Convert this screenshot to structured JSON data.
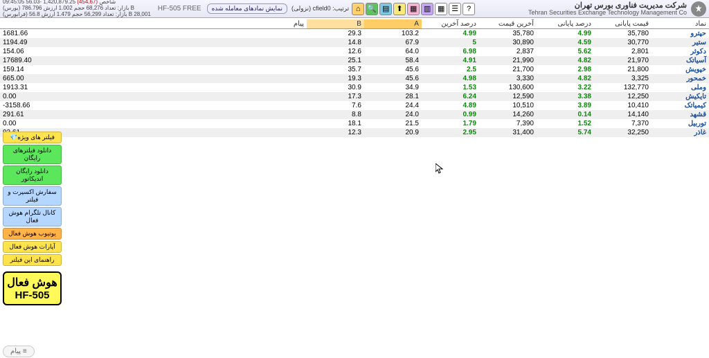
{
  "header": {
    "brand_fa": "شرکت مدیریت فناوری بورس تهران",
    "brand_en": "Tehran Securities Exchange Technology Management Co",
    "sort_label": "ترتیب:",
    "sort_value": "cfield0 (نزولی)",
    "tab_label": "نمایش نمادهای معامله شده",
    "hf": "HF-505 FREE",
    "stats": {
      "l1a": "شاخص",
      "l1b": "1,420,879.25",
      "l1c": "(454.67)",
      "l1d": "-56.03 09:45:05",
      "l2a": "(بورس)",
      "l2b": "بازار: تعداد 68,276 حجم 1.002 ارزش 786.796 B",
      "l3a": "(فرابورس)",
      "l3b": "بازار: تعداد 56,299 حجم 1.479 ارزش 56.8 B 28,001"
    }
  },
  "columns": [
    "نماد",
    "قیمت پایانی",
    "درصد پایانی",
    "آخرین قیمت",
    "درصد آخرین",
    "A",
    "B",
    "پیام"
  ],
  "rows": [
    {
      "sym": "حپترو",
      "close": "35,780",
      "closePct": "4.99",
      "last": "35,780",
      "lastPct": "4.99",
      "a": "103.2",
      "b": "29.3",
      "msg": "1681.66"
    },
    {
      "sym": "ستیر",
      "close": "30,770",
      "closePct": "4.59",
      "last": "30,890",
      "lastPct": "5",
      "a": "67.9",
      "b": "14.8",
      "msg": "1194.49"
    },
    {
      "sym": "دکوثر",
      "close": "2,801",
      "closePct": "5.62",
      "last": "2,837",
      "lastPct": "6.98",
      "a": "64.0",
      "b": "12.6",
      "msg": "154.06"
    },
    {
      "sym": "آسیاتک",
      "close": "21,970",
      "closePct": "4.82",
      "last": "21,990",
      "lastPct": "4.91",
      "a": "58.4",
      "b": "25.1",
      "msg": "17689.40"
    },
    {
      "sym": "خپویش",
      "close": "21,800",
      "closePct": "2.98",
      "last": "21,700",
      "lastPct": "2.5",
      "a": "45.6",
      "b": "35.7",
      "msg": "159.14"
    },
    {
      "sym": "خمحور",
      "close": "3,325",
      "closePct": "4.82",
      "last": "3,330",
      "lastPct": "4.98",
      "a": "45.6",
      "b": "19.3",
      "msg": "665.00"
    },
    {
      "sym": "وملی",
      "close": "132,770",
      "closePct": "3.22",
      "last": "130,600",
      "lastPct": "1.53",
      "a": "34.9",
      "b": "30.9",
      "msg": "1913.31"
    },
    {
      "sym": "تایکیش",
      "close": "12,250",
      "closePct": "3.38",
      "last": "12,590",
      "lastPct": "6.24",
      "a": "28.1",
      "b": "17.3",
      "msg": "0.00"
    },
    {
      "sym": "کیمیاتک",
      "close": "10,410",
      "closePct": "3.89",
      "last": "10,510",
      "lastPct": "4.89",
      "a": "24.4",
      "b": "7.6",
      "msg": "-3158.66"
    },
    {
      "sym": "قشهد",
      "close": "14,140",
      "closePct": "0.14",
      "last": "14,260",
      "lastPct": "0.99",
      "a": "24.0",
      "b": "8.8",
      "msg": "291.61"
    },
    {
      "sym": "توربیل",
      "close": "7,370",
      "closePct": "1.52",
      "last": "7,390",
      "lastPct": "1.79",
      "a": "21.5",
      "b": "18.1",
      "msg": "0.00"
    },
    {
      "sym": "غاذر",
      "close": "32,250",
      "closePct": "5.74",
      "last": "31,400",
      "lastPct": "2.95",
      "a": "20.9",
      "b": "12.3",
      "msg": "93.61"
    }
  ],
  "side": [
    "فیلتر های ویژه💎",
    "دانلود فیلترهای رایگان",
    "دانلود رایگان اندیکاتور",
    "سفارش اکسپرت و فیلتر",
    "کانال تلگرام هوش فعال",
    "یوتیوب هوش فعال",
    "آپارات هوش فعال",
    "راهنمای این فیلتر"
  ],
  "badge": {
    "l1": "هوش فعال",
    "l2": "HF-505"
  },
  "footer": "پیام ≡"
}
